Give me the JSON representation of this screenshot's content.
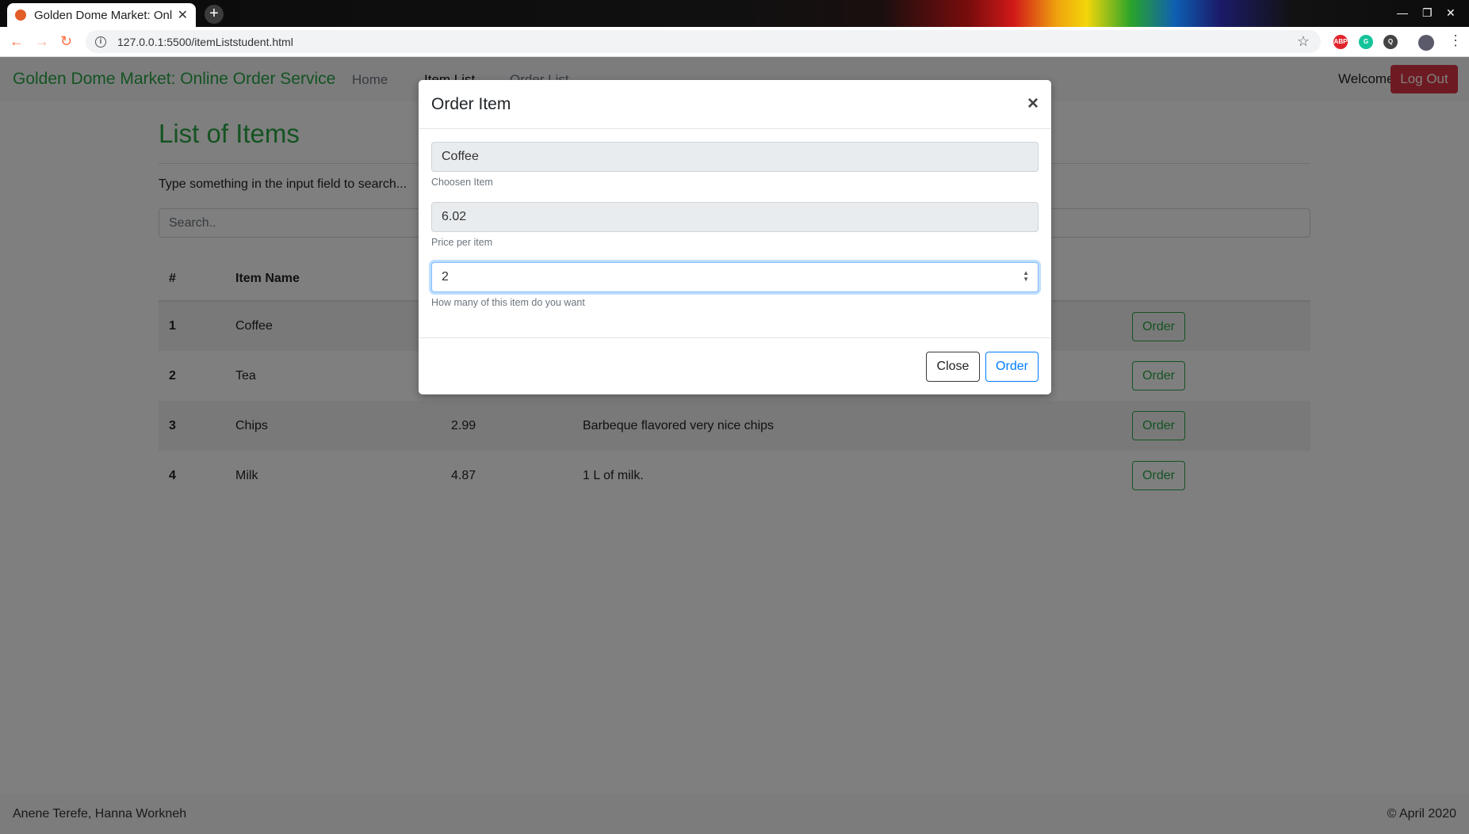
{
  "browser": {
    "tab_title": "Golden Dome Market: Online Order Service",
    "new_tab_label": "+",
    "url": "127.0.0.1:5500/itemListstudent.html",
    "extensions": [
      "ABP",
      "G",
      "Q"
    ]
  },
  "navbar": {
    "brand": "Golden Dome Market: Online Order Service",
    "links": [
      "Home",
      "Item List",
      "Order List"
    ],
    "active_link": "Item List",
    "welcome": "Welcome",
    "logout_label": "Log Out"
  },
  "main": {
    "title": "List of Items",
    "search_hint": "Type something in the input field to search...",
    "search_placeholder": "Search..",
    "table": {
      "headers": [
        "#",
        "Item Name"
      ],
      "rows": [
        {
          "num": "1",
          "name": "Coffee",
          "price": "",
          "description": "",
          "action": "Order"
        },
        {
          "num": "2",
          "name": "Tea",
          "price": "",
          "description": "",
          "action": "Order"
        },
        {
          "num": "3",
          "name": "Chips",
          "price": "2.99",
          "description": "Barbeque flavored very nice chips",
          "action": "Order"
        },
        {
          "num": "4",
          "name": "Milk",
          "price": "4.87",
          "description": "1 L of milk.",
          "action": "Order"
        }
      ]
    }
  },
  "footer": {
    "authors": "Anene Terefe, Hanna Workneh",
    "copyright": "© April 2020"
  },
  "modal": {
    "title": "Order Item",
    "close_symbol": "×",
    "item_value": "Coffee",
    "item_help": "Choosen Item",
    "price_value": "6.02",
    "price_help": "Price per item",
    "quantity_value": "2",
    "quantity_help": "How many of this item do you want",
    "close_label": "Close",
    "order_label": "Order"
  },
  "colors": {
    "brand_green": "#28a745",
    "danger": "#dc3545",
    "primary": "#007bff"
  }
}
